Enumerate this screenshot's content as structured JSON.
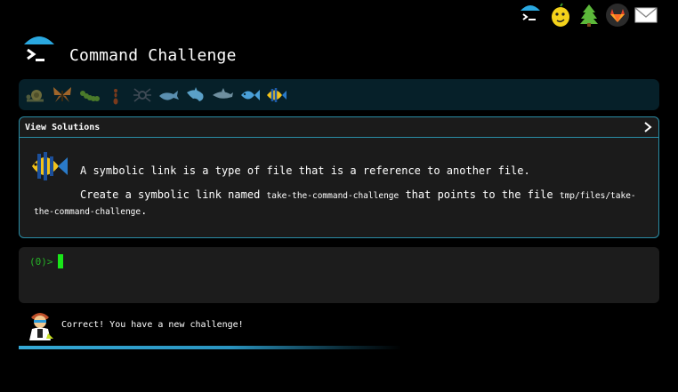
{
  "header": {
    "title": "Command Challenge",
    "top_icons": [
      "terminal-umbrella-icon",
      "lemon-face-icon",
      "evergreen-tree-icon",
      "gitlab-icon",
      "envelope-icon"
    ]
  },
  "progress": {
    "icons": [
      "snail-icon",
      "butterfly-icon",
      "caterpillar-icon",
      "ant-icon",
      "spider-icon",
      "whale-icon",
      "shark-icon",
      "dolphin-icon",
      "fish-icon",
      "tropical-fish-icon"
    ]
  },
  "panel": {
    "view_solutions": "View Solutions",
    "line1": "A symbolic link is a type of file that is a reference to another file.",
    "line2_pre": "Create a symbolic link named ",
    "line2_code1": "take-the-command-challenge",
    "line2_mid": " that points to the file ",
    "line2_code2": "tmp/files/take-the-command-challenge",
    "line2_post": "."
  },
  "terminal": {
    "prompt": "(0)>"
  },
  "feedback": {
    "message": "Correct! You have a new challenge!"
  },
  "colors": {
    "accent": "#2a8da6",
    "panel_bg": "#1b1b1b",
    "progress_bg": "#062029",
    "prompt_green": "#26b326",
    "cursor_green": "#19e619"
  }
}
